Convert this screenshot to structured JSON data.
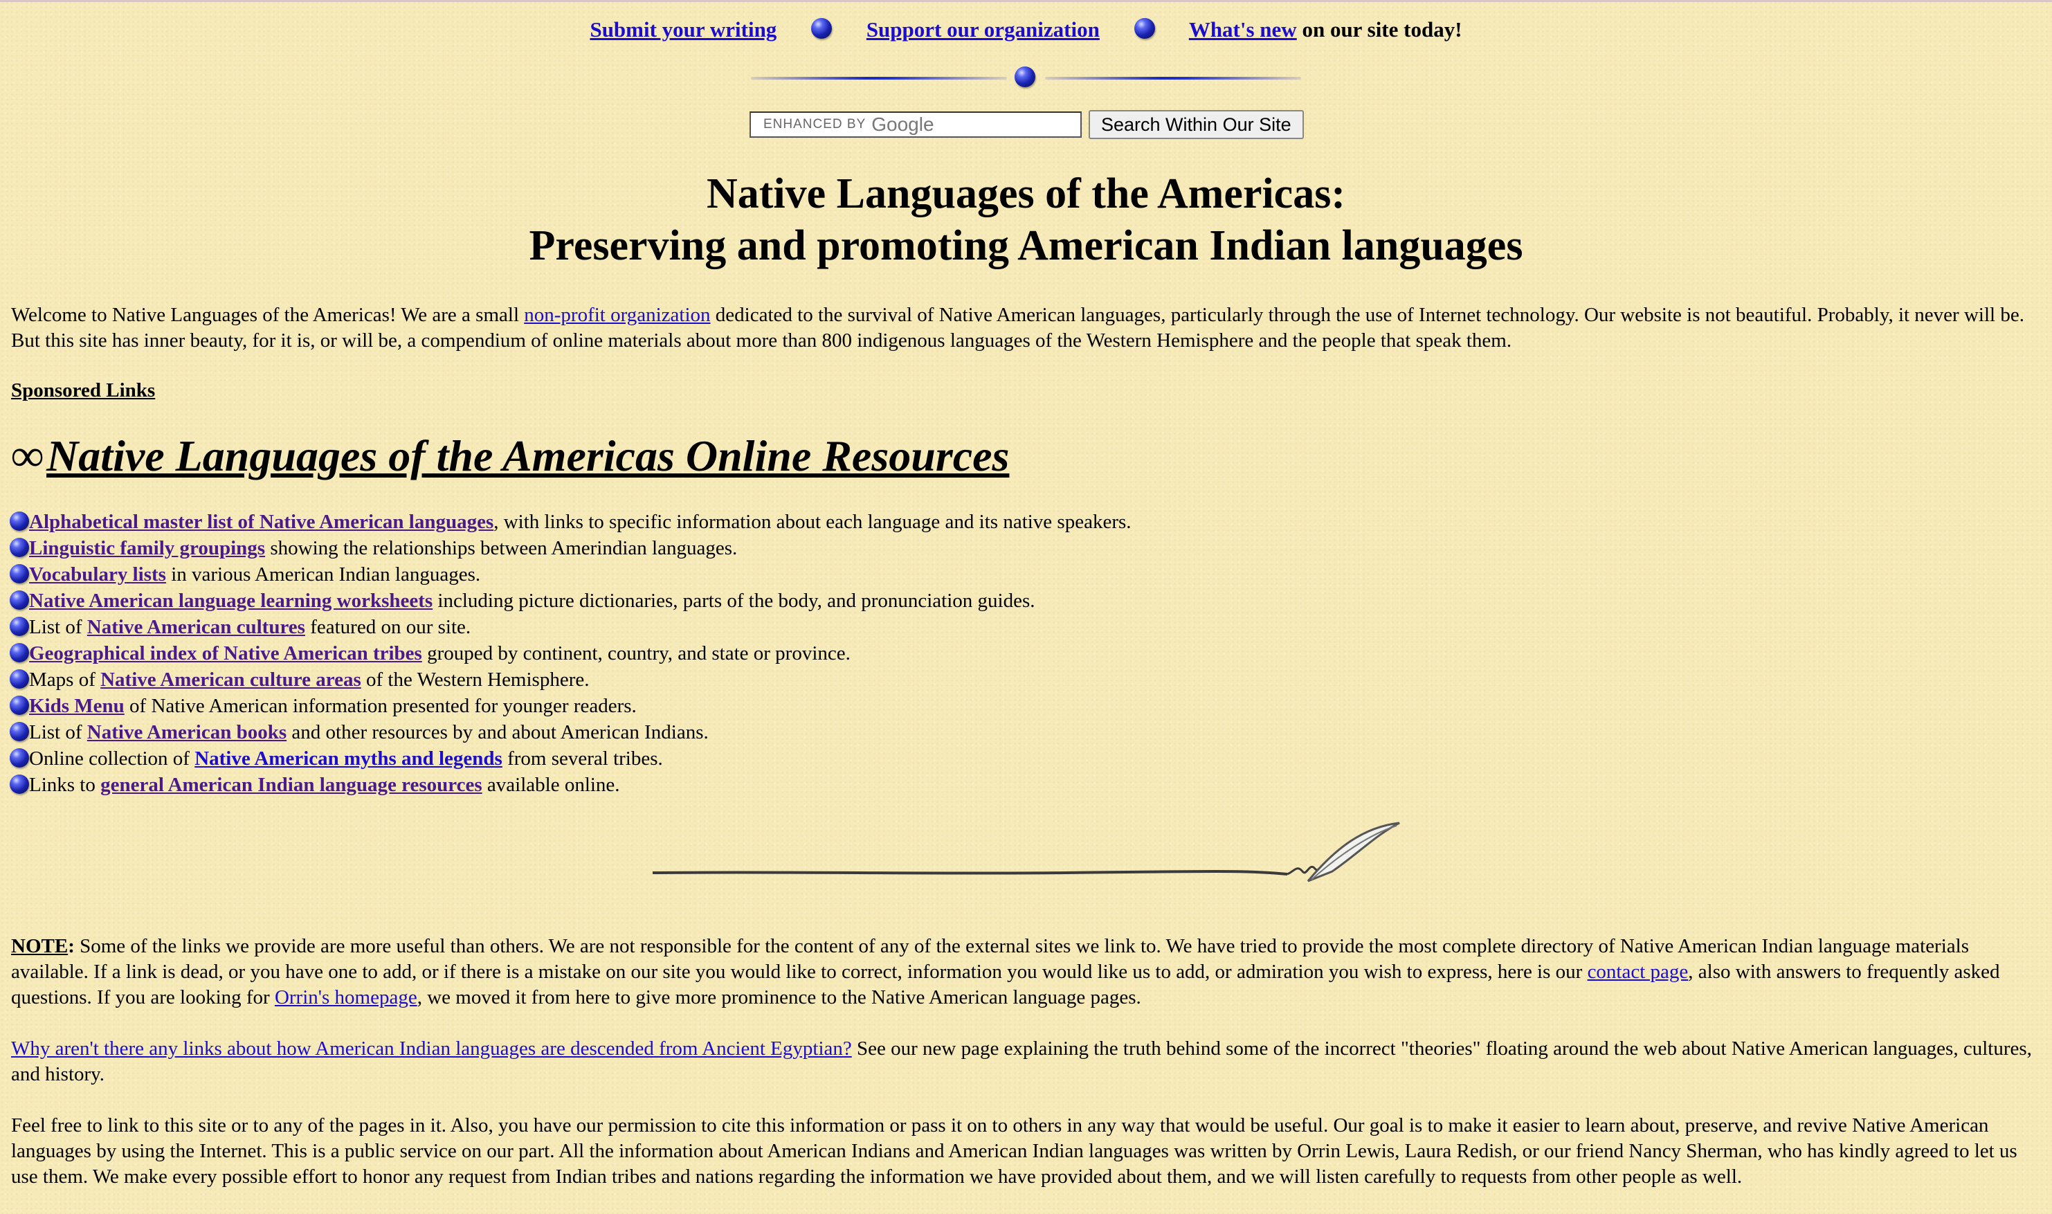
{
  "nav": {
    "submit": "Submit your writing",
    "support": "Support our organization",
    "whats_new": "What's new",
    "suffix": "on our site today!"
  },
  "search": {
    "enhanced_by": "ENHANCED BY",
    "google": "Google",
    "button": "Search Within Our Site"
  },
  "title": {
    "line1": "Native Languages of the Americas:",
    "line2": "Preserving and promoting American Indian languages"
  },
  "intro": {
    "before": "Welcome to Native Languages of the Americas! We are a small",
    "link": "non-profit organization",
    "after": "dedicated to the survival of Native American languages, particularly through the use of Internet technology. Our website is not beautiful. Probably, it never will be. But this site has inner beauty, for it is, or will be, a compendium of online materials about more than 800 indigenous languages of the Western Hemisphere and the people that speak them."
  },
  "sponsored": "Sponsored Links",
  "resources": {
    "heading": "Native Languages of the Americas Online Resources",
    "items": [
      {
        "pre": "",
        "link": "Alphabetical master list of Native American languages",
        "post": ", with links to specific information about each language and its native speakers."
      },
      {
        "pre": "",
        "link": "Linguistic family groupings",
        "post": " showing the relationships between Amerindian languages."
      },
      {
        "pre": "",
        "link": "Vocabulary lists",
        "post": " in various American Indian languages."
      },
      {
        "pre": "",
        "link": "Native American language learning worksheets",
        "post": " including picture dictionaries, parts of the body, and pronunciation guides."
      },
      {
        "pre": "List of ",
        "link": "Native American cultures",
        "post": " featured on our site."
      },
      {
        "pre": "",
        "link": "Geographical index of Native American tribes",
        "post": " grouped by continent, country, and state or province."
      },
      {
        "pre": "Maps of ",
        "link": "Native American culture areas",
        "post": " of the Western Hemisphere."
      },
      {
        "pre": "",
        "link": "Kids Menu",
        "post": " of Native American information presented for younger readers."
      },
      {
        "pre": "List of ",
        "link": "Native American books",
        "post": " and other resources by and about American Indians."
      },
      {
        "pre": "Online collection of ",
        "link": "Native American myths and legends",
        "post": " from several tribes."
      },
      {
        "pre": "Links to ",
        "link": "general American Indian language resources",
        "post": " available online."
      }
    ]
  },
  "note": {
    "label": "NOTE",
    "colon": ":",
    "text1": " Some of the links we provide are more useful than others. We are not responsible for the content of any of the external sites we link to. We have tried to provide the most complete directory of Native American Indian language materials available. If a link is dead, or you have one to add, or if there is a mistake on our site you would like to correct, information you would like us to add, or admiration you wish to express, here is our ",
    "contact_link": "contact page",
    "text2": ", also with answers to frequently asked questions. If you are looking for ",
    "orrin_link": "Orrin's homepage",
    "text3": ", we moved it from here to give more prominence to the Native American language pages."
  },
  "egypt": {
    "link": "Why aren't there any links about how American Indian languages are descended from Ancient Egyptian?",
    "text": " See our new page explaining the truth behind some of the incorrect \"theories\" floating around the web about Native American languages, cultures, and history."
  },
  "permission": "Feel free to link to this site or to any of the pages in it. Also, you have our permission to cite this information or pass it on to others in any way that would be useful. Our goal is to make it easier to learn about, preserve, and revive Native American languages by using the Internet. This is a public service on our part. All the information about American Indians and American Indian languages was written by Orrin Lewis, Laura Redish, or our friend Nancy Sherman, who has kindly agreed to let us use them. We make every possible effort to honor any request from Indian tribes and nations regarding the information we have provided about them, and we will listen carefully to requests from other people as well."
}
